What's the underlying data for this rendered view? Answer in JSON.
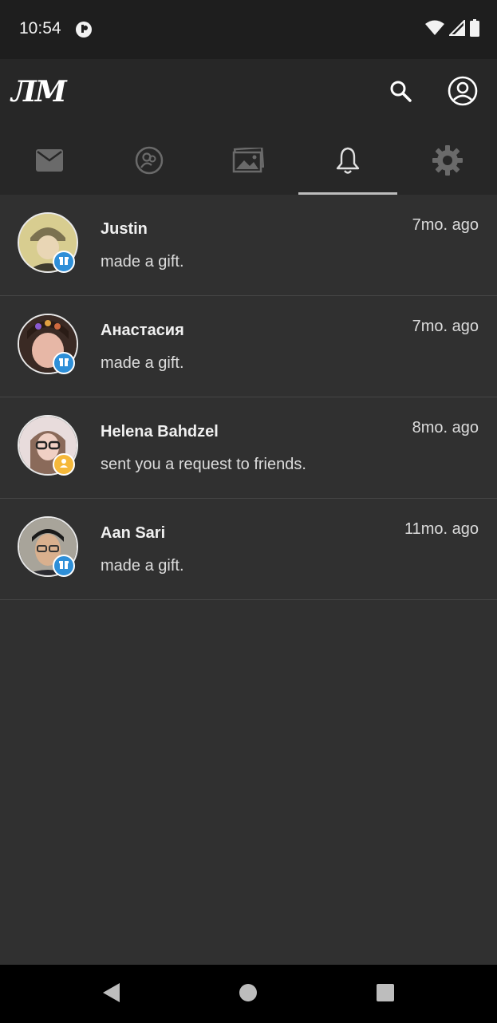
{
  "status_bar": {
    "time": "10:54",
    "icons": [
      "app-notification-icon",
      "wifi-icon",
      "cell-signal-icon",
      "battery-icon"
    ]
  },
  "app_bar": {
    "logo": "ЛМ",
    "icons": [
      "search-icon",
      "account-icon"
    ]
  },
  "tabs": [
    {
      "icon": "mail-icon",
      "active": false
    },
    {
      "icon": "friends-icon",
      "active": false
    },
    {
      "icon": "photos-icon",
      "active": false
    },
    {
      "icon": "bell-icon",
      "active": true
    },
    {
      "icon": "gear-icon",
      "active": false
    }
  ],
  "notifications": [
    {
      "name": "Justin",
      "action": "made a gift.",
      "time": "7mo. ago",
      "badge": "gift-icon"
    },
    {
      "name": "Анастасия",
      "action": "made a gift.",
      "time": "7mo. ago",
      "badge": "gift-icon"
    },
    {
      "name": "Helena Bahdzel",
      "action": "sent you a request to friends.",
      "time": "8mo. ago",
      "badge": "friend-request-icon"
    },
    {
      "name": "Aan Sari",
      "action": "made a gift.",
      "time": "11mo. ago",
      "badge": "gift-icon"
    }
  ],
  "nav_bar": {
    "icons": [
      "back-icon",
      "home-icon",
      "recents-icon"
    ]
  },
  "colors": {
    "background": "#303030",
    "app_bar": "#272727",
    "status_bar": "#1e1e1e",
    "gift_badge": "#2e8fd8",
    "friend_badge": "#f5b83a",
    "divider": "#454545"
  }
}
